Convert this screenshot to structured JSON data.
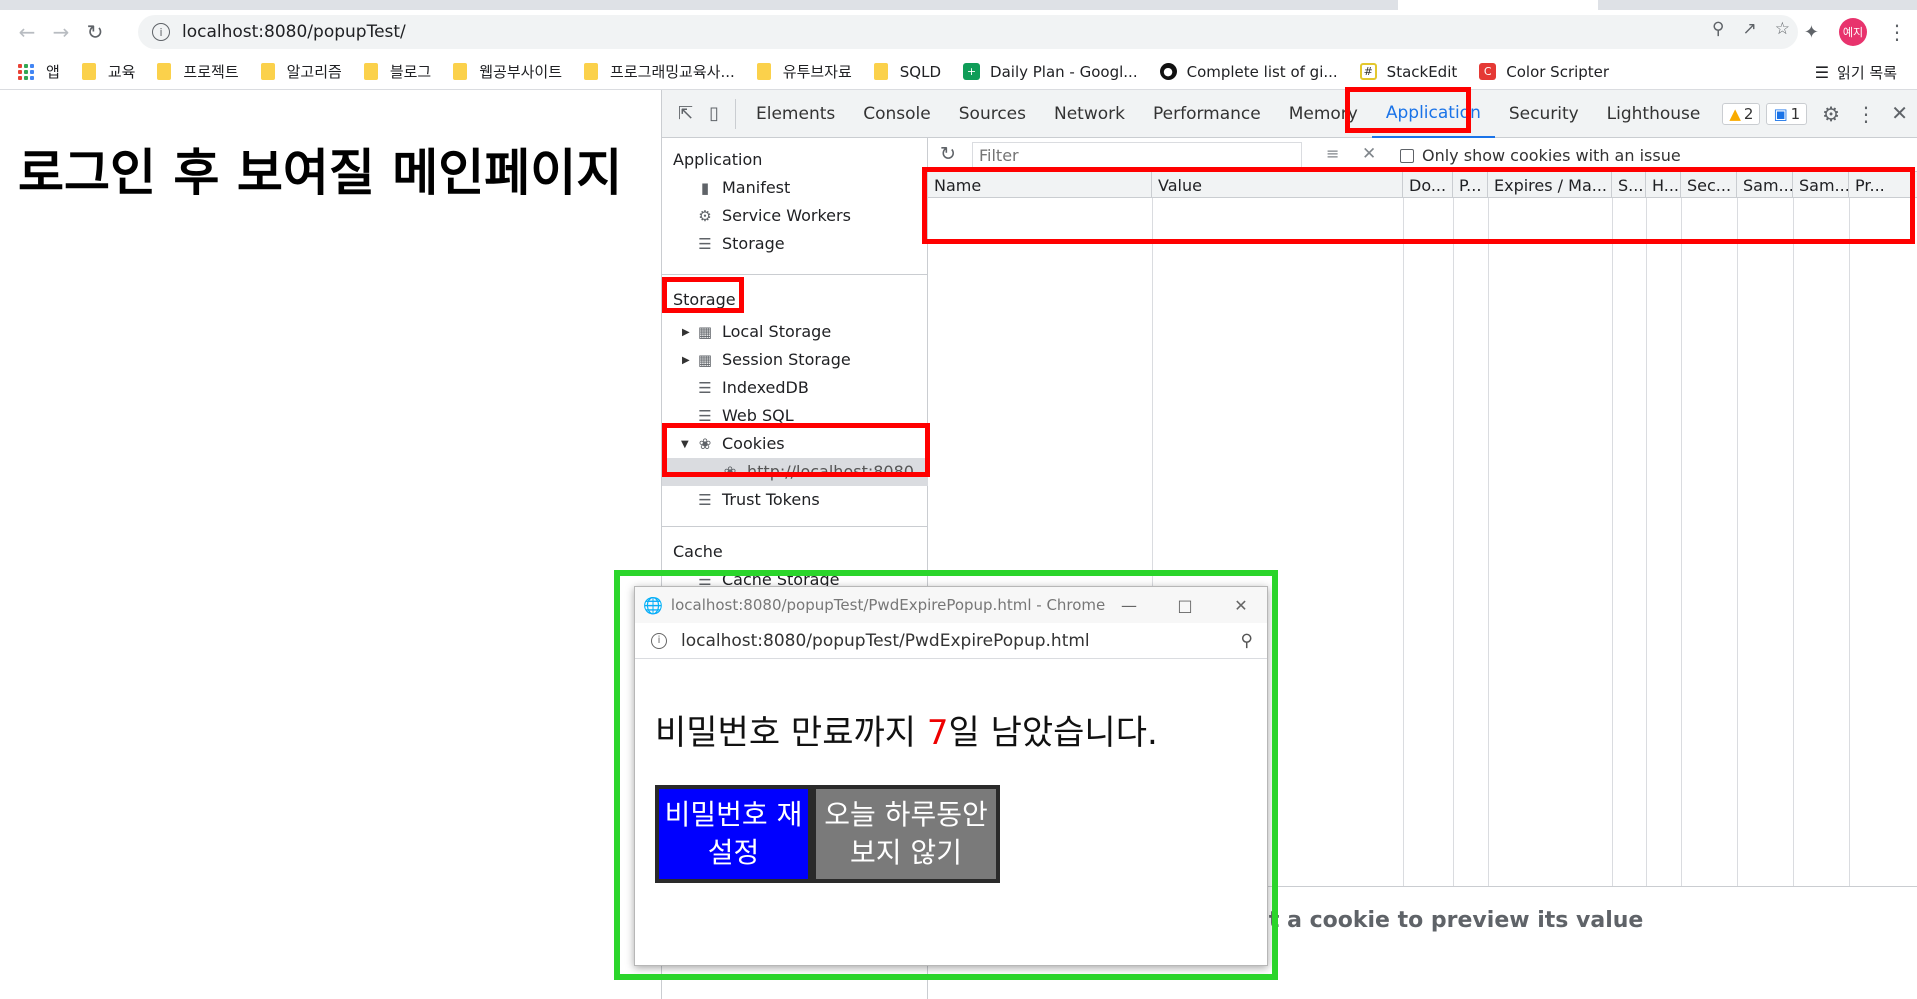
{
  "browser": {
    "url": "localhost:8080/popupTest/",
    "profile_initials": "예지",
    "bookmarks": [
      {
        "label": "앱",
        "icon": "apps-grid-icon"
      },
      {
        "label": "교육",
        "icon": "folder-icon"
      },
      {
        "label": "프로젝트",
        "icon": "folder-icon"
      },
      {
        "label": "알고리즘",
        "icon": "folder-icon"
      },
      {
        "label": "블로그",
        "icon": "folder-icon"
      },
      {
        "label": "웹공부사이트",
        "icon": "folder-icon"
      },
      {
        "label": "프로그래밍교육사...",
        "icon": "folder-icon"
      },
      {
        "label": "유투브자료",
        "icon": "folder-icon"
      },
      {
        "label": "SQLD",
        "icon": "folder-icon"
      },
      {
        "label": "Daily Plan - Googl...",
        "icon": "google-sheets-icon"
      },
      {
        "label": "Complete list of gi...",
        "icon": "github-icon"
      },
      {
        "label": "StackEdit",
        "icon": "stackedit-icon"
      },
      {
        "label": "Color Scripter",
        "icon": "color-scripter-icon"
      }
    ],
    "reading_list": "읽기 목록"
  },
  "page": {
    "heading": "로그인 후 보여질 메인페이지"
  },
  "devtools": {
    "tabs": [
      "Elements",
      "Console",
      "Sources",
      "Network",
      "Performance",
      "Memory",
      "Application",
      "Security",
      "Lighthouse"
    ],
    "active_tab": "Application",
    "warnings_count": "2",
    "messages_count": "1",
    "sidebar": {
      "application_section": "Application",
      "application_items": [
        "Manifest",
        "Service Workers",
        "Storage"
      ],
      "storage_section": "Storage",
      "storage_items": [
        "Local Storage",
        "Session Storage",
        "IndexedDB",
        "Web SQL",
        "Cookies"
      ],
      "cookie_origin": "http://localhost:8080",
      "trust_tokens": "Trust Tokens",
      "cache_section": "Cache",
      "cache_items": [
        "Cache Storage"
      ]
    },
    "filter_placeholder": "Filter",
    "only_issues_label": "Only show cookies with an issue",
    "columns": [
      "Name",
      "Value",
      "Do...",
      "P...",
      "Expires / Ma...",
      "S...",
      "H...",
      "Sec...",
      "Sam...",
      "Sam...",
      "Pr..."
    ],
    "preview_text": "Select a cookie to preview its value"
  },
  "popup": {
    "window_title": "localhost:8080/popupTest/PwdExpirePopup.html - Chrome",
    "url": "localhost:8080/popupTest/PwdExpirePopup.html",
    "message_before": "비밀번호 만료까지 ",
    "days": "7",
    "message_after": "일 남았습니다.",
    "reset_button": "비밀번호 재설정",
    "hide_today_button": "오늘 하루동안 보지 않기"
  },
  "colors": {
    "highlight_red": "#ff0000",
    "highlight_green": "#2bd52b",
    "reset_button_bg": "#0000ff",
    "hide_button_bg": "#7a7a7a",
    "days_color": "#e00000"
  }
}
